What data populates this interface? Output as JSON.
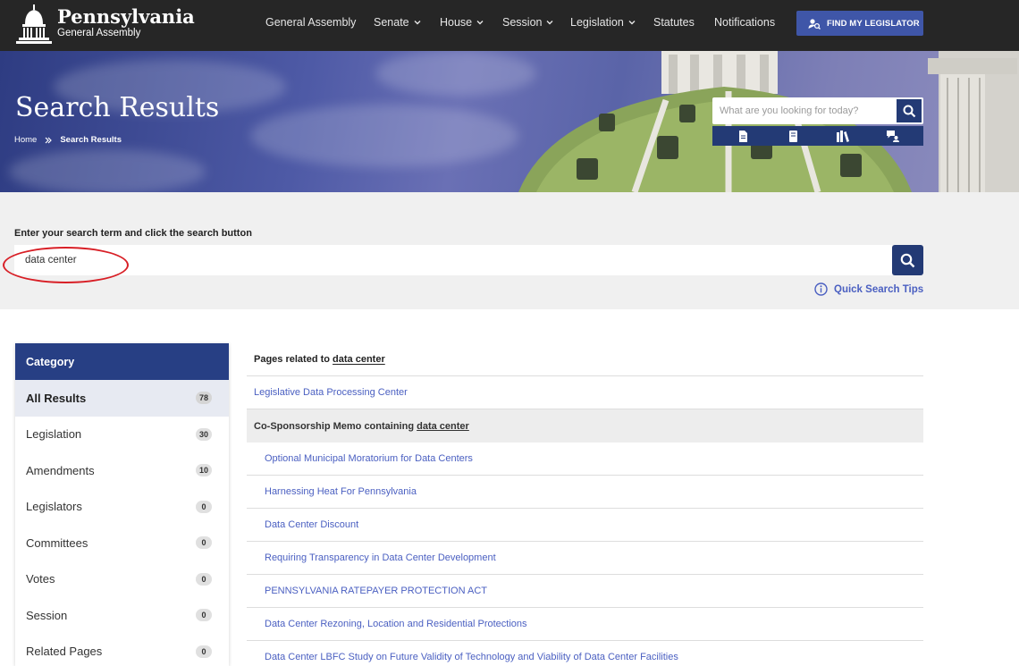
{
  "header": {
    "brand_title": "Pennsylvania",
    "brand_subtitle": "General Assembly",
    "nav": [
      {
        "label": "General Assembly"
      },
      {
        "label": "Senate"
      },
      {
        "label": "House"
      },
      {
        "label": "Session"
      },
      {
        "label": "Legislation"
      },
      {
        "label": "Statutes"
      },
      {
        "label": "Notifications"
      }
    ],
    "find_legislator_label": "FIND MY LEGISLATOR"
  },
  "hero": {
    "title": "Search Results",
    "breadcrumb_home": "Home",
    "breadcrumb_current": "Search Results",
    "search_placeholder": "What are you looking for today?"
  },
  "search": {
    "label": "Enter your search term and click the search button",
    "value": "data center",
    "tips_label": "Quick Search Tips"
  },
  "sidebar": {
    "title": "Category",
    "items": [
      {
        "label": "All Results",
        "count": "78"
      },
      {
        "label": "Legislation",
        "count": "30"
      },
      {
        "label": "Amendments",
        "count": "10"
      },
      {
        "label": "Legislators",
        "count": "0"
      },
      {
        "label": "Committees",
        "count": "0"
      },
      {
        "label": "Votes",
        "count": "0"
      },
      {
        "label": "Session",
        "count": "0"
      },
      {
        "label": "Related Pages",
        "count": "0"
      }
    ]
  },
  "results": {
    "pages_prefix": "Pages related to",
    "pages_term": "data center",
    "pages": [
      "Legislative Data Processing Center"
    ],
    "memo_prefix": "Co-Sponsorship Memo containing",
    "memo_term": "data center",
    "memos": [
      "Optional Municipal Moratorium for Data Centers",
      "Harnessing Heat For Pennsylvania",
      "Data Center Discount",
      "Requiring Transparency in Data Center Development",
      "PENNSYLVANIA RATEPAYER PROTECTION ACT",
      "Data Center Rezoning, Location and Residential Protections",
      "Data Center LBFC Study on Future Validity of Technology and Viability of Data Center Facilities"
    ]
  },
  "colors": {
    "topbar": "#262626",
    "accent_blue": "#273f84",
    "button_blue": "#3f56a8",
    "link_blue": "#4a5fc1",
    "highlight_ring": "#d81f26"
  }
}
